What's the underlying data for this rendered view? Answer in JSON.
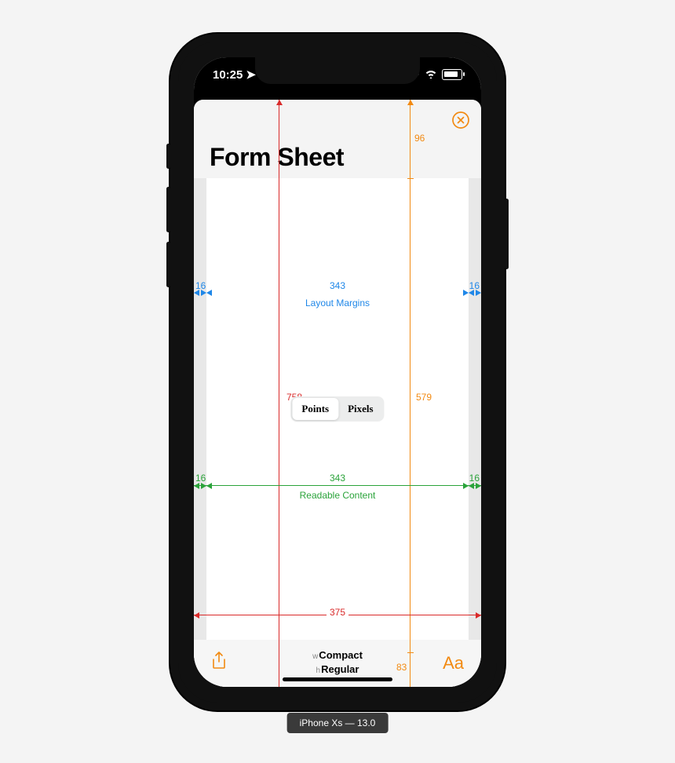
{
  "status": {
    "time": "10:25"
  },
  "sheet": {
    "title": "Form Sheet"
  },
  "segmented": {
    "points": "Points",
    "pixels": "Pixels"
  },
  "layout_margins": {
    "left": "16",
    "width": "343",
    "right": "16",
    "label": "Layout Margins"
  },
  "readable_content": {
    "left": "16",
    "width": "343",
    "right": "16",
    "label": "Readable Content"
  },
  "full": {
    "width": "375",
    "height": "758"
  },
  "safe": {
    "top": "96",
    "content": "579",
    "bottom": "83"
  },
  "size_class": {
    "w_prefix": "w",
    "w": "Compact",
    "h_prefix": "h",
    "h": "Regular"
  },
  "toolbar": {
    "aa": "Aa"
  },
  "device_caption": "iPhone Xs — 13.0"
}
